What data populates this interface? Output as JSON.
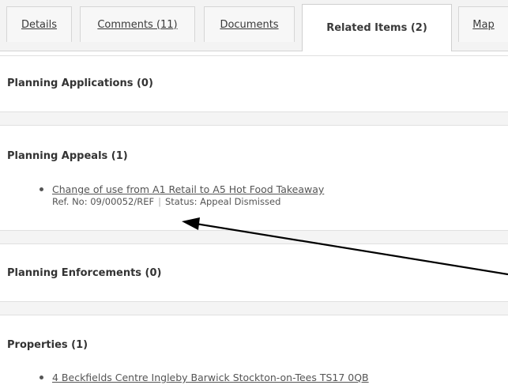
{
  "tabs": [
    {
      "label": "Details"
    },
    {
      "label": "Comments (11)"
    },
    {
      "label": "Documents"
    },
    {
      "label": "Related Items (2)"
    },
    {
      "label": "Map"
    }
  ],
  "active_tab": "Related Items (2)",
  "sections": {
    "applications": {
      "title": "Planning Applications (0)"
    },
    "appeals": {
      "title": "Planning Appeals (1)",
      "items": [
        {
          "link": "Change of use from A1 Retail to A5 Hot Food Takeaway",
          "ref": "Ref. No: 09/00052/REF",
          "status": "Status: Appeal Dismissed"
        }
      ]
    },
    "enforcements": {
      "title": "Planning Enforcements (0)"
    },
    "properties": {
      "title": "Properties (1)",
      "items": [
        {
          "link": "4 Beckfields Centre Ingleby Barwick Stockton-on-Tees TS17 0QB"
        }
      ]
    }
  },
  "colors": {
    "arrow": "#000000",
    "band": "#f4f4f4",
    "text": "#333333"
  },
  "icons": {
    "annotation": "arrow-icon",
    "bullet": "bullet-icon"
  }
}
